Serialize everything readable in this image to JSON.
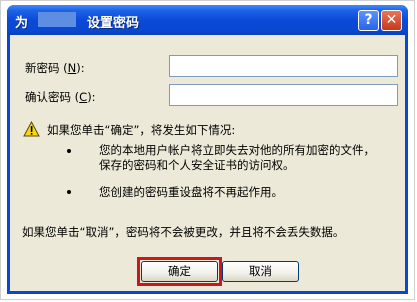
{
  "window": {
    "title_prefix": "为",
    "title": "设置密码",
    "help_label": "?",
    "close_label": "✕"
  },
  "form": {
    "new_password_label": "新密码 (",
    "new_password_key": "N",
    "new_password_suffix": "):",
    "new_password_value": "",
    "confirm_password_label": "确认密码 (",
    "confirm_password_key": "C",
    "confirm_password_suffix": "):",
    "confirm_password_value": ""
  },
  "warning": {
    "icon": "warning-icon",
    "intro": "如果您单击“确定”，将发生如下情况:",
    "bullets": [
      {
        "lines": [
          "您的本地用户帐户将立即失去对他的所有加密的文件，",
          "保存的密码和个人安全证书的访问权。"
        ]
      },
      {
        "lines": [
          "您创建的密码重设盘将不再起作用。"
        ]
      }
    ],
    "cancel_note": "如果您单击“取消”，密码将不会被更改，并且将不会丢失数据。"
  },
  "buttons": {
    "ok_label": "确定",
    "cancel_label": "取消"
  },
  "colors": {
    "titlebar": "#0a46d6",
    "client_bg": "#ece9d8",
    "highlight": "#d0141b"
  }
}
